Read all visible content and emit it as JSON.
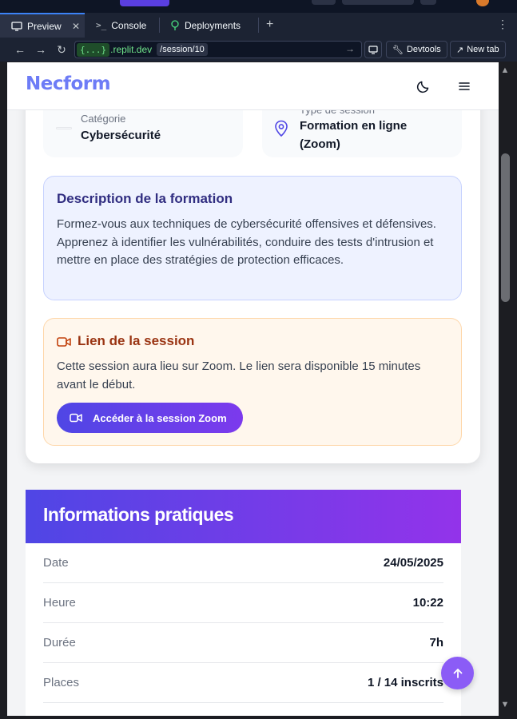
{
  "browser": {
    "tabs": [
      {
        "label": "Preview",
        "icon": "monitor-icon",
        "active": true
      },
      {
        "label": "Console",
        "icon": "terminal-icon",
        "active": false
      },
      {
        "label": "Deployments",
        "icon": "deploy-icon",
        "active": false
      }
    ],
    "address": {
      "domain_token": "{...}",
      "domain_suffix": ".replit.dev",
      "path": "/session/10"
    },
    "devtools_label": "Devtools",
    "newtab_label": "New tab"
  },
  "site": {
    "logo": "Necform",
    "theme_icon": "moon-icon",
    "menu_icon": "hamburger-menu-icon"
  },
  "session": {
    "category_label": "Catégorie",
    "category_value": "Cybersécurité",
    "type_label": "Type de session",
    "type_value": "Formation en ligne (Zoom)",
    "description_title": "Description de la formation",
    "description_text": "Formez-vous aux techniques de cybersécurité offensives et défensives. Apprenez à identifier les vulnérabilités, conduire des tests d'intrusion et mettre en place des stratégies de protection efficaces.",
    "link_title": "Lien de la session",
    "link_text": "Cette session aura lieu sur Zoom. Le lien sera disponible 15 minutes avant le début.",
    "zoom_button_label": "Accéder à la session Zoom"
  },
  "practical_info": {
    "title": "Informations pratiques",
    "rows": [
      {
        "label": "Date",
        "value": "24/05/2025"
      },
      {
        "label": "Heure",
        "value": "10:22"
      },
      {
        "label": "Durée",
        "value": "7h"
      },
      {
        "label": "Places",
        "value": "1 / 14 inscrits"
      }
    ]
  },
  "colors": {
    "accent": "#4f46e5",
    "accent_end": "#9333ea",
    "logo": "#6d7cf6"
  }
}
